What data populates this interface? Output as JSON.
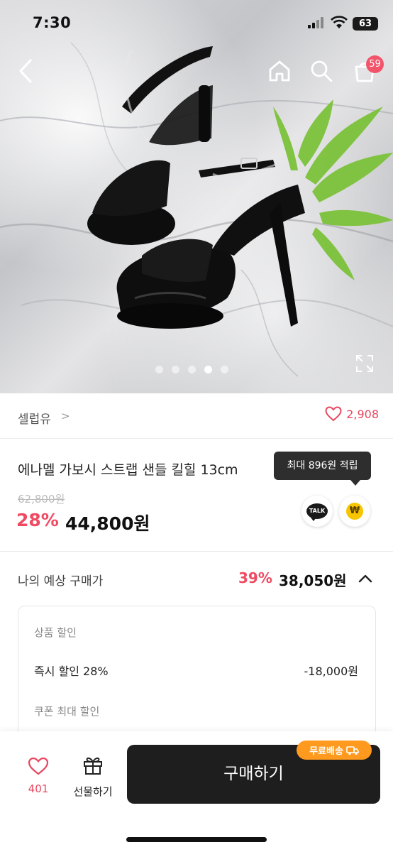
{
  "status_bar": {
    "time": "7:30",
    "battery": "63"
  },
  "header": {
    "cart_badge": "59"
  },
  "gallery": {
    "total_images": 5,
    "active_index": 4
  },
  "seller": {
    "name": "셀럽유",
    "chevron": ">",
    "likes": "2,908"
  },
  "product": {
    "title": "에나멜 가보시 스트랩 샌들 킬힐 13cm",
    "original_price": "62,800원",
    "discount_rate": "28%",
    "price": "44,800원",
    "points_tooltip": "최대 896원 적립",
    "talk_label": "TALK",
    "point_symbol": "₩"
  },
  "expected_price": {
    "label": "나의 예상 구매가",
    "discount_rate": "39%",
    "price": "38,050원",
    "breakdown": {
      "section1": "상품 할인",
      "item_label": "즉시 할인 28%",
      "item_value": "-18,000원",
      "section2": "쿠폰 최대 할인"
    }
  },
  "bottom_bar": {
    "wish_count": "401",
    "gift_label": "선물하기",
    "buy_label": "구매하기",
    "free_shipping": "무료배송"
  },
  "colors": {
    "accent": "#f04a62",
    "buy_button": "#1e1e1e",
    "free_shipping": "#ff9a1f"
  }
}
